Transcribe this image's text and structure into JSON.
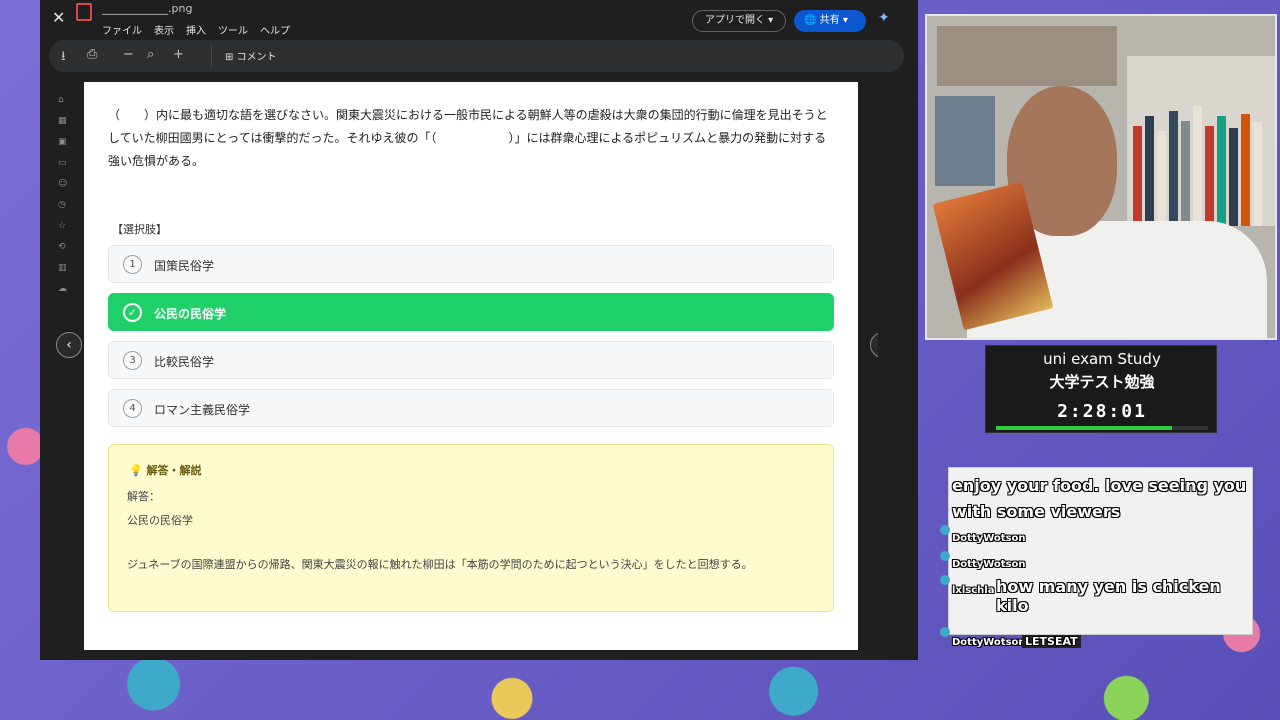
{
  "docs": {
    "doc_name": "____________.png",
    "menu": [
      "ファイル",
      "表示",
      "挿入",
      "ツール",
      "ヘルプ"
    ],
    "open_app_label": "アプリで開く ▾",
    "share_label": "共有  ▾",
    "comment_label": "コメント"
  },
  "question": {
    "text": "（　　）内に最も適切な語を選びなさい。関東大震災における一般市民による朝鮮人等の虐殺は大衆の集団的行動に倫理を見出そうとしていた柳田國男にとっては衝撃的だった。それゆえ彼の「（　　　　　　）」には群衆心理によるポピュリズムと暴力の発動に対する強い危惧がある。",
    "choices_label": "【選択肢】",
    "choices": [
      {
        "num": "1",
        "label": "国策民俗学",
        "selected": false
      },
      {
        "num": "✓",
        "label": "公民の民俗学",
        "selected": true
      },
      {
        "num": "3",
        "label": "比較民俗学",
        "selected": false
      },
      {
        "num": "4",
        "label": "ロマン主義民俗学",
        "selected": false
      }
    ]
  },
  "answer": {
    "heading": "💡 解答・解説",
    "label": "解答：",
    "value": "公民の民俗学",
    "explanation": "ジュネーブの国際連盟からの帰路、関東大震災の報に触れた柳田は「本筋の学問のために起つという決心」をしたと回想する。"
  },
  "timer": {
    "title": "uni exam Study",
    "subtitle": "大学テスト勉強",
    "time": "2:28:01",
    "progress": 0.83
  },
  "chat": {
    "top_message": "enjoy your food. love seeing you with some viewers",
    "messages": [
      {
        "user": "DottyWotson",
        "text": ""
      },
      {
        "user": "DottyWotson",
        "text": ""
      },
      {
        "user": "lxlschla",
        "text": "how many yen is chicken kilo"
      },
      {
        "user": "DottyWotson",
        "text": "LETSEAT"
      }
    ]
  },
  "colors": {
    "accent_green": "#1fcf68",
    "answer_yellow": "#fffbcf",
    "share_blue": "#0b57d0"
  }
}
